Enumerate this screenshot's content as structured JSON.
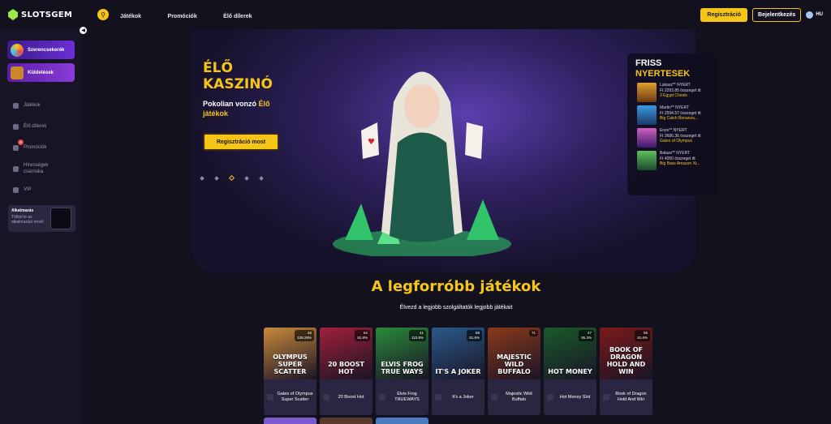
{
  "header": {
    "logo_text": "SLOTSGEM",
    "nav": [
      "Játékok",
      "Promóciók",
      "Élő dílerek"
    ],
    "register": "Regisztráció",
    "login": "Bejelentkezés",
    "language": "HU"
  },
  "sidebar": {
    "promos": [
      "Szerencsekerék",
      "Küldetések"
    ],
    "items": [
      "Játékok",
      "Élő dílerek",
      "Promóciók",
      "Híresség­ek csarnoka",
      "VIP"
    ],
    "promo_badge": "9",
    "app": {
      "title": "Alkalmazás",
      "subtitle": "Töltsd le az alkalmazást most!"
    }
  },
  "hero": {
    "title_line1": "ÉLŐ",
    "title_line2": "KASZINÓ",
    "subtitle_a": "Pokolian vonzó ",
    "subtitle_highlight": "Élő",
    "subtitle_b": "játékok",
    "cta": "Regisztráció most"
  },
  "winners": {
    "title_line1": "FRISS",
    "title_line2": "NYERTESEK",
    "items": [
      {
        "user": "Lukasz** NYERT",
        "amount": "Ft 2293.85 összeget itt",
        "game": "3 Egypt Chests"
      },
      {
        "user": "Martin** NYERT",
        "amount": "Ft 2594.57 összeget itt",
        "game": "Big Catch Bonanza..."
      },
      {
        "user": "Enzo** NYERT",
        "amount": "Ft 3686.36 összeget itt",
        "game": "Gates of Olympus"
      },
      {
        "user": "Balazs** NYERT",
        "amount": "Ft 4050 összeget itt",
        "game": "Big Bass Amazon Xt..."
      }
    ]
  },
  "hot_games": {
    "title": "A legforróbb játékok",
    "subtitle": "Élvezd a legjobb szolgáltatók legjobb játékait",
    "games": [
      {
        "name": "Gates of Olympus Super Scatter",
        "art": "OLYMPUS SUPER SCATTER",
        "players": "46",
        "rtp": "108.28%",
        "color": "#c98a3a"
      },
      {
        "name": "20 Boost Hot",
        "art": "20 BOOST HOT",
        "players": "64",
        "rtp": "91.8%",
        "color": "#a0203a"
      },
      {
        "name": "Elvis Frog TRUEWAYS",
        "art": "ELVIS FROG TRUE WAYS",
        "players": "41",
        "rtp": "110.8%",
        "color": "#2a8a3a"
      },
      {
        "name": "It's a Joker",
        "art": "IT'S A JOKER",
        "players": "58",
        "rtp": "91.6%",
        "color": "#2a5a8a"
      },
      {
        "name": "Majestic Wild Buffalo",
        "art": "MAJESTIC WILD BUFFALO",
        "players": "71",
        "rtp": "",
        "color": "#8a3a1a"
      },
      {
        "name": "Hot Money Slot",
        "art": "HOT MONEY",
        "players": "47",
        "rtp": "95.3%",
        "color": "#1a5a2a"
      },
      {
        "name": "Book of Dragon Hold And Win",
        "art": "BOOK OF DRAGON HOLD AND WIN",
        "players": "58",
        "rtp": "91.6%",
        "color": "#7a1a1a"
      }
    ]
  }
}
